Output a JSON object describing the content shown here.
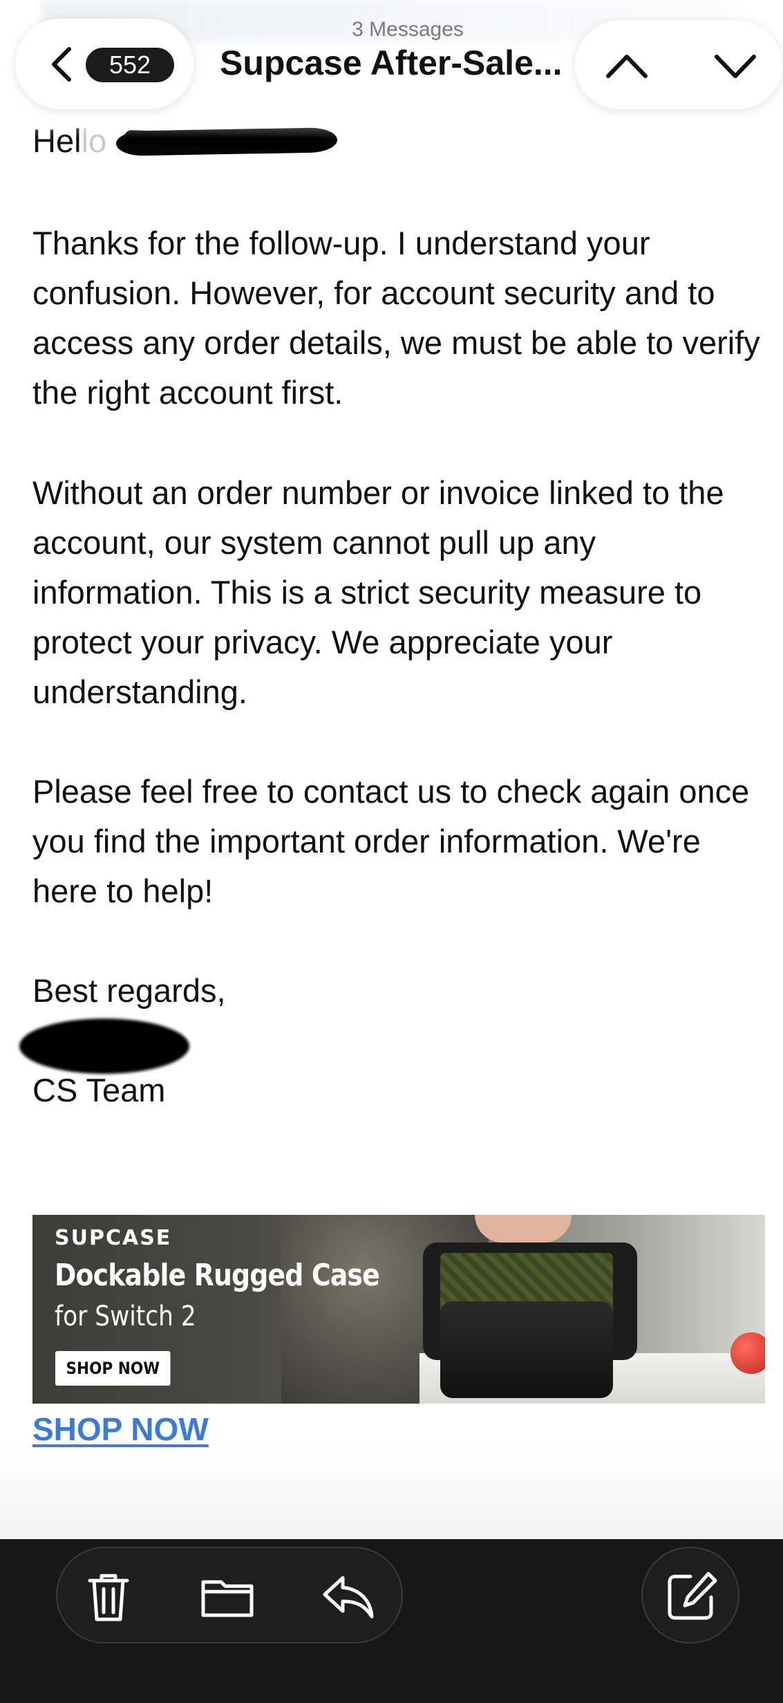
{
  "header": {
    "unread_count": "552",
    "message_count": "3 Messages",
    "title": "Supcase After-Sale..."
  },
  "email": {
    "greeting_visible": "Hel",
    "greeting_faded": "lo",
    "paragraphs": [
      "Thanks for the follow-up. I understand your confusion. However, for account security and to access any order details, we must be able to verify the right account first.",
      "Without an order number or invoice linked to the account, our system cannot pull up any information. This is a strict security measure to protect your privacy. We appreciate your understanding.",
      "Please feel free to contact us to check again once you find the important order information. We're here to help!"
    ],
    "sign_off": "Best regards,",
    "team": "CS Team"
  },
  "banner": {
    "brand": "SUPCASE",
    "title": "Dockable Rugged Case",
    "subtitle": "for Switch 2",
    "button": "SHOP NOW"
  },
  "shop_link": "SHOP NOW",
  "icons": {
    "back": "chevron-left-icon",
    "up": "chevron-up-icon",
    "down": "chevron-down-icon",
    "trash": "trash-icon",
    "folder": "folder-icon",
    "reply": "reply-icon",
    "compose": "compose-icon"
  },
  "colors": {
    "link": "#3a7bd5",
    "badge": "#1b1b1b",
    "toolbar": "#171717"
  }
}
